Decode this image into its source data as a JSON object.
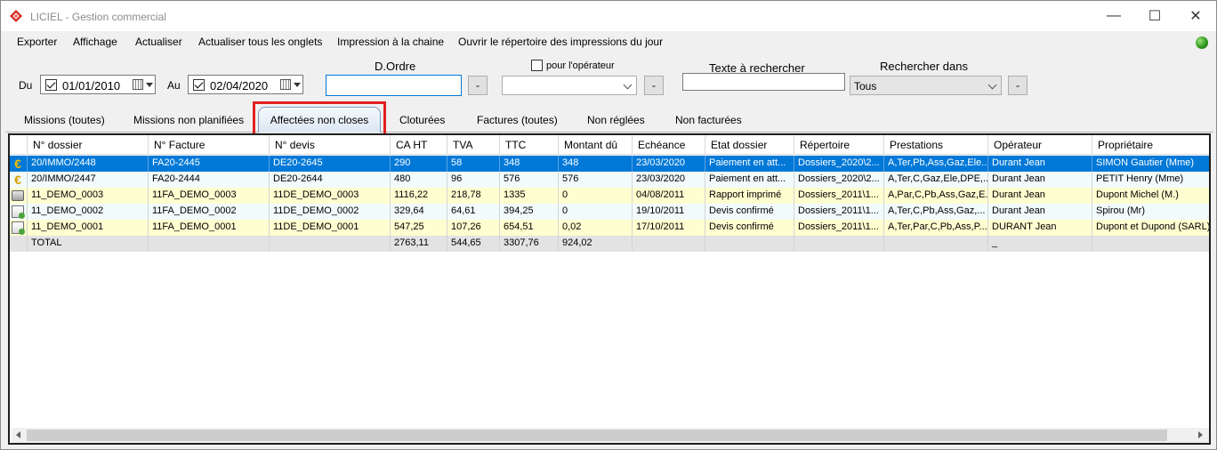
{
  "window": {
    "title": "LICIEL - Gestion commercial",
    "minimize": "—",
    "maximize": "☐",
    "close": "✕"
  },
  "menu": [
    "Exporter",
    "Affichage",
    "Actualiser",
    "Actualiser tous les onglets",
    "Impression à la chaine",
    "Ouvrir le répertoire des impressions du jour"
  ],
  "filters": {
    "du_label": "Du",
    "du_date": "01/01/2010",
    "au_label": "Au",
    "au_date": "02/04/2020",
    "dordre_label": "D.Ordre",
    "dordre_value": "",
    "minus": "-",
    "operator_label": "pour l'opérateur",
    "operator_value": "",
    "search_label": "Texte à rechercher",
    "search_value": "",
    "search_in_label": "Rechercher dans",
    "search_in_value": "Tous"
  },
  "tabs": [
    "Missions (toutes)",
    "Missions non planifiées",
    "Affectées non closes",
    "Cloturées",
    "Factures (toutes)",
    "Non réglées",
    "Non facturées"
  ],
  "active_tab": "Affectées non closes",
  "grid": {
    "columns": [
      "N° dossier",
      "N° Facture",
      "N° devis",
      "CA HT",
      "TVA",
      "TTC",
      "Montant dû",
      "Echéance",
      "Etat dossier",
      "Répertoire",
      "Prestations",
      "Opérateur",
      "Propriétaire"
    ],
    "rows": [
      [
        "20/IMMO/2448",
        "FA20-2445",
        "DE20-2645",
        "290",
        "58",
        "348",
        "348",
        "23/03/2020",
        "Paiement en att...",
        "Dossiers_2020\\2...",
        "A,Ter,Pb,Ass,Gaz,Ele...",
        "Durant Jean",
        "SIMON Gautier (Mme)"
      ],
      [
        "20/IMMO/2447",
        "FA20-2444",
        "DE20-2644",
        "480",
        "96",
        "576",
        "576",
        "23/03/2020",
        "Paiement en att...",
        "Dossiers_2020\\2...",
        "A,Ter,C,Gaz,Ele,DPE,...",
        "Durant Jean",
        "PETIT Henry (Mme)"
      ],
      [
        "11_DEMO_0003",
        "11FA_DEMO_0003",
        "11DE_DEMO_0003",
        "1116,22",
        "218,78",
        "1335",
        "0",
        "04/08/2011",
        "Rapport imprimé",
        "Dossiers_2011\\1...",
        "A,Par,C,Pb,Ass,Gaz,E...",
        "Durant Jean",
        "Dupont Michel (M.)"
      ],
      [
        "11_DEMO_0002",
        "11FA_DEMO_0002",
        "11DE_DEMO_0002",
        "329,64",
        "64,61",
        "394,25",
        "0",
        "19/10/2011",
        "Devis confirmé",
        "Dossiers_2011\\1...",
        "A,Ter,C,Pb,Ass,Gaz,...",
        "Durant Jean",
        "Spirou (Mr)"
      ],
      [
        "11_DEMO_0001",
        "11FA_DEMO_0001",
        "11DE_DEMO_0001",
        "547,25",
        "107,26",
        "654,51",
        "0,02",
        "17/10/2011",
        "Devis confirmé",
        "Dossiers_2011\\1...",
        "A,Ter,Par,C,Pb,Ass,P...",
        "DURANT Jean",
        "Dupont et Dupond (SARL)"
      ]
    ],
    "row_icons": [
      "euro-icon",
      "euro-icon",
      "printer-icon",
      "document-icon",
      "document-icon"
    ],
    "total": [
      "TOTAL",
      "",
      "",
      "2763,11",
      "544,65",
      "3307,76",
      "924,02",
      "",
      "",
      "",
      "",
      "_",
      ""
    ]
  },
  "colors": {
    "selection": "#0078d7",
    "row_yellow": "#fffed0",
    "row_light": "#f1fbfb",
    "highlight": "#e02020"
  }
}
